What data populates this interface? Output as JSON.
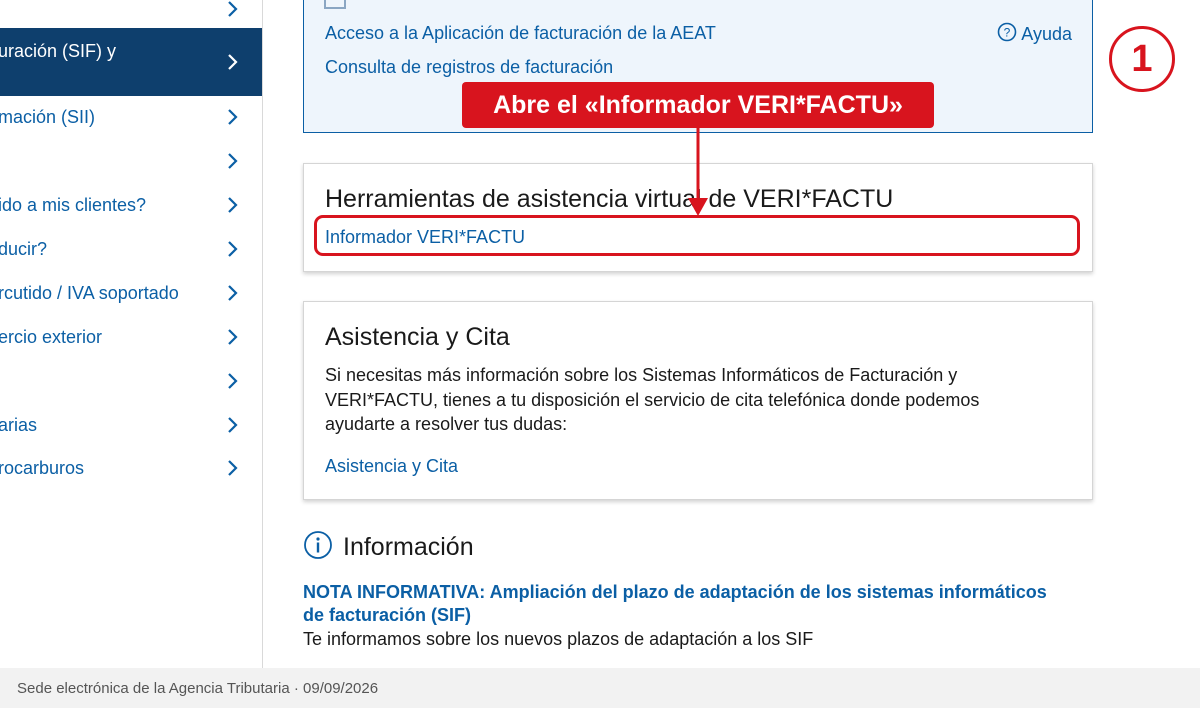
{
  "sidebar": {
    "items": [
      {
        "label": ""
      },
      {
        "label": "uración (SIF) y"
      },
      {
        "label": "mación (SII)"
      },
      {
        "label": ""
      },
      {
        "label": "ido a mis clientes?"
      },
      {
        "label": "ducir?"
      },
      {
        "label": "rcutido / IVA soportado"
      },
      {
        "label": "ercio exterior"
      },
      {
        "label": ""
      },
      {
        "label": "arias"
      },
      {
        "label": "rocarburos"
      }
    ]
  },
  "access": {
    "link1": "Acceso a la Aplicación de facturación de la AEAT",
    "link2": "Consulta de registros de facturación",
    "help_label": "Ayuda",
    "help_icon": "question-circle-icon"
  },
  "annotation": {
    "label": "Abre el «Informador VERI*FACTU»",
    "step": "1",
    "color": "#d8141e"
  },
  "tools_card": {
    "title": "Herramientas de asistencia virtual de VERI*FACTU",
    "link": "Informador VERI*FACTU"
  },
  "assist_card": {
    "title": "Asistencia y Cita",
    "text": "Si necesitas más información sobre los Sistemas Informáticos de Facturación y VERI*FACTU, tienes a tu disposición el servicio de cita telefónica donde podemos ayudarte a resolver tus dudas:",
    "link": "Asistencia y Cita"
  },
  "info": {
    "title": "Información",
    "icon": "info-circle-icon",
    "news_title": "NOTA INFORMATIVA: Ampliación del plazo de adaptación de los sistemas informáticos de facturación (SIF)",
    "news_desc": "Te informamos sobre los nuevos plazos de adaptación a los SIF"
  },
  "footer": {
    "text": "Sede electrónica de la Agencia Tributaria · 09/09/2026"
  },
  "colors": {
    "brand": "#0b5fa5",
    "active_nav": "#0e3f6d",
    "annotation_red": "#d8141e"
  }
}
